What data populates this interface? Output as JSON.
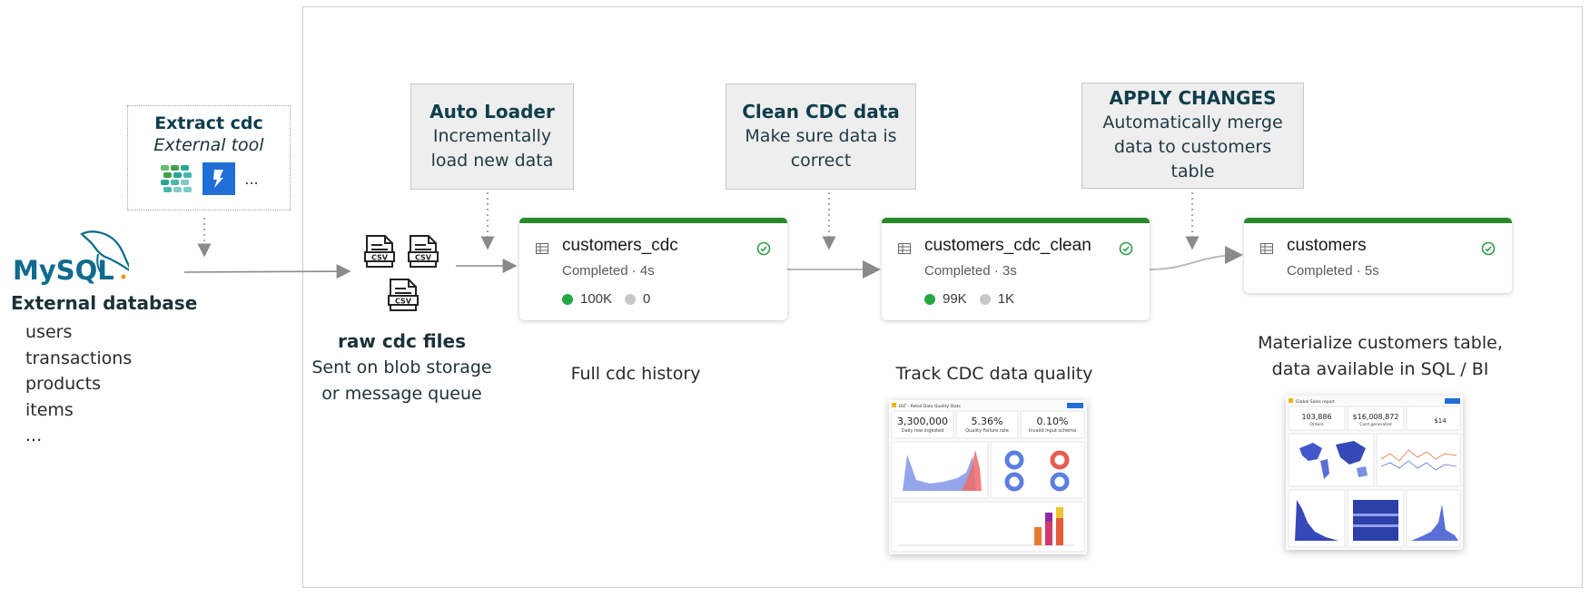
{
  "source": {
    "title": "External database",
    "logo_text": "MySQL",
    "tables": [
      "users",
      "transactions",
      "products",
      "items",
      "..."
    ]
  },
  "extract": {
    "title": "Extract cdc",
    "subtitle": "External tool",
    "more": "..."
  },
  "notes": [
    {
      "title": "Auto Loader",
      "lines": [
        "Incrementally",
        "load new data"
      ]
    },
    {
      "title": "Clean CDC data",
      "lines": [
        "Make sure data is",
        "correct"
      ]
    },
    {
      "title": "APPLY CHANGES",
      "lines": [
        "Automatically merge",
        "data to customers",
        "table"
      ]
    }
  ],
  "csv": {
    "icon_label": "CSV",
    "title": "raw cdc files",
    "lines": [
      "Sent on blob storage",
      "or message queue"
    ]
  },
  "cards": [
    {
      "name": "customers_cdc",
      "status": "Completed · 4s",
      "ok": "100K",
      "other": "0"
    },
    {
      "name": "customers_cdc_clean",
      "status": "Completed · 3s",
      "ok": "99K",
      "other": "1K"
    },
    {
      "name": "customers",
      "status": "Completed · 5s"
    }
  ],
  "captions": {
    "c1": "Full cdc history",
    "c2": "Track CDC data quality",
    "c3_line1": "Materialize customers table,",
    "c3_line2": "data available in SQL / BI"
  },
  "dash1": {
    "title": "DLT - Retail Data Quality Stats",
    "kpis": [
      {
        "value": "3,300,000",
        "label": "Daily row ingested"
      },
      {
        "value": "5.36%",
        "label": "Quality Failure rate"
      },
      {
        "value": "0.10%",
        "label": "Invalid input schema"
      }
    ]
  },
  "dash2": {
    "title": "Global Sales report",
    "kpis": [
      {
        "value": "103,886",
        "label": "Orders"
      },
      {
        "value": "$16,008,872",
        "label": "Card generated"
      },
      {
        "value": "$14",
        "label": ""
      }
    ]
  },
  "colors": {
    "green": "#2a8a2a",
    "status_ok": "#27a744",
    "status_other": "#c8c8c8",
    "note_bg": "#eeeeee",
    "accent": "#1f6fd6"
  }
}
